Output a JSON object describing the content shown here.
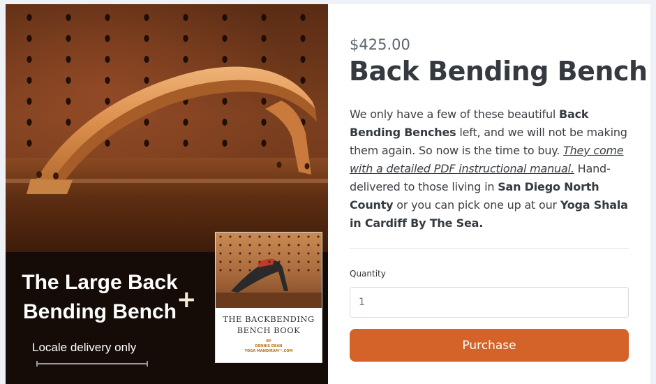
{
  "hero": {
    "headline_line1": "The Large Back",
    "headline_line2": "Bending Bench",
    "plus_symbol": "+",
    "delivery_note": "Locale delivery only",
    "book": {
      "title_line1": "THE BACKBENDING",
      "title_line2": "BENCH BOOK",
      "author_by": "BY",
      "author_name": "DENNIS DEAN",
      "author_site": "YOGA MANDIRAM™.COM"
    }
  },
  "product": {
    "price": "$425.00",
    "title": "Back Bending Bench",
    "description": {
      "t1": "We only have a few of these beautiful ",
      "b1": "Back Bending Benches",
      "t2": " left, and we will not be making them again. So now is the time to buy. ",
      "link": "They come with a detailed PDF instructional manual.",
      "t3": " Hand-delivered to those living in ",
      "b2": "San Diego North County",
      "t4": " or you can pick one up at our ",
      "b3": "Yoga Shala in Cardiff By The Sea."
    },
    "quantity_label": "Quantity",
    "quantity_value": "1",
    "purchase_label": "Purchase"
  },
  "colors": {
    "accent": "#d4632a",
    "title_text": "#343a40",
    "page_bg": "#eef1f6"
  }
}
